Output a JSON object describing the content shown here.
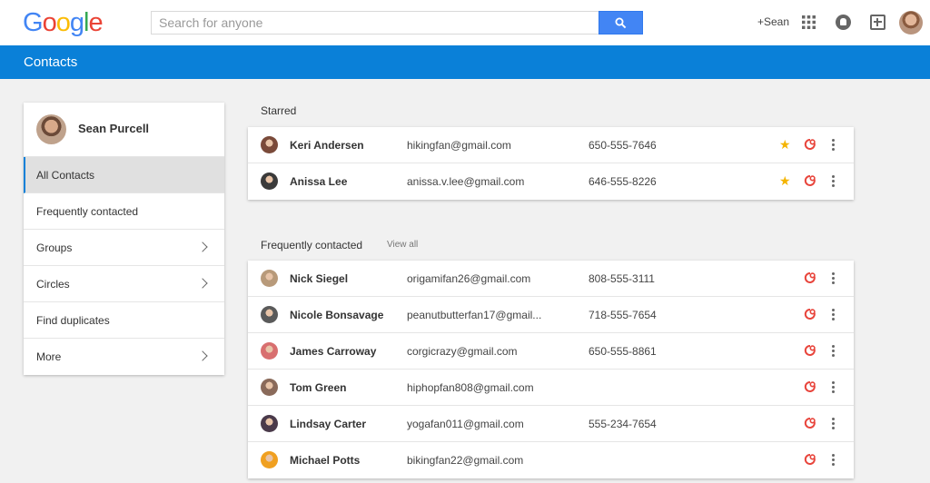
{
  "header": {
    "logo_letters": [
      "G",
      "o",
      "o",
      "g",
      "l",
      "e"
    ],
    "search_placeholder": "Search for anyone",
    "plus_user": "+Sean"
  },
  "appbar": {
    "title": "Contacts"
  },
  "sidebar": {
    "profile_name": "Sean Purcell",
    "items": [
      {
        "label": "All Contacts",
        "active": true,
        "chevron": false
      },
      {
        "label": "Frequently contacted",
        "active": false,
        "chevron": false
      },
      {
        "label": "Groups",
        "active": false,
        "chevron": true
      },
      {
        "label": "Circles",
        "active": false,
        "chevron": true
      },
      {
        "label": "Find duplicates",
        "active": false,
        "chevron": false
      },
      {
        "label": "More",
        "active": false,
        "chevron": true
      }
    ]
  },
  "starred": {
    "label": "Starred",
    "contacts": [
      {
        "name": "Keri Andersen",
        "email": "hikingfan@gmail.com",
        "phone": "650-555-7646",
        "starred": true,
        "avatar_color": "#7a4a3a"
      },
      {
        "name": "Anissa Lee",
        "email": "anissa.v.lee@gmail.com",
        "phone": "646-555-8226",
        "starred": true,
        "avatar_color": "#3a3a3a"
      }
    ]
  },
  "frequent": {
    "label": "Frequently contacted",
    "view_all": "View all",
    "contacts": [
      {
        "name": "Nick Siegel",
        "email": "origamifan26@gmail.com",
        "phone": "808-555-3111",
        "avatar_color": "#b89a7a"
      },
      {
        "name": "Nicole Bonsavage",
        "email": "peanutbutterfan17@gmail...",
        "phone": "718-555-7654",
        "avatar_color": "#5a5a5a"
      },
      {
        "name": "James Carroway",
        "email": "corgicrazy@gmail.com",
        "phone": "650-555-8861",
        "avatar_color": "#d86f6f"
      },
      {
        "name": "Tom Green",
        "email": "hiphopfan808@gmail.com",
        "phone": "",
        "avatar_color": "#8a6a5a"
      },
      {
        "name": "Lindsay Carter",
        "email": "yogafan011@gmail.com",
        "phone": "555-234-7654",
        "avatar_color": "#4a3a4a"
      },
      {
        "name": "Michael Potts",
        "email": "bikingfan22@gmail.com",
        "phone": "",
        "avatar_color": "#f0a020"
      }
    ]
  },
  "colors": {
    "brand_blue": "#0a80d8",
    "search_blue": "#4285f4",
    "hangout_red": "#e8453c",
    "star_yellow": "#f4b400"
  },
  "icons": {
    "search": "search-icon",
    "apps": "apps-grid-icon",
    "notifications": "notifications-icon",
    "share": "share-plus-icon",
    "star": "star-icon",
    "hangout": "hangouts-icon",
    "more": "more-vert-icon",
    "chevron": "chevron-right-icon"
  }
}
